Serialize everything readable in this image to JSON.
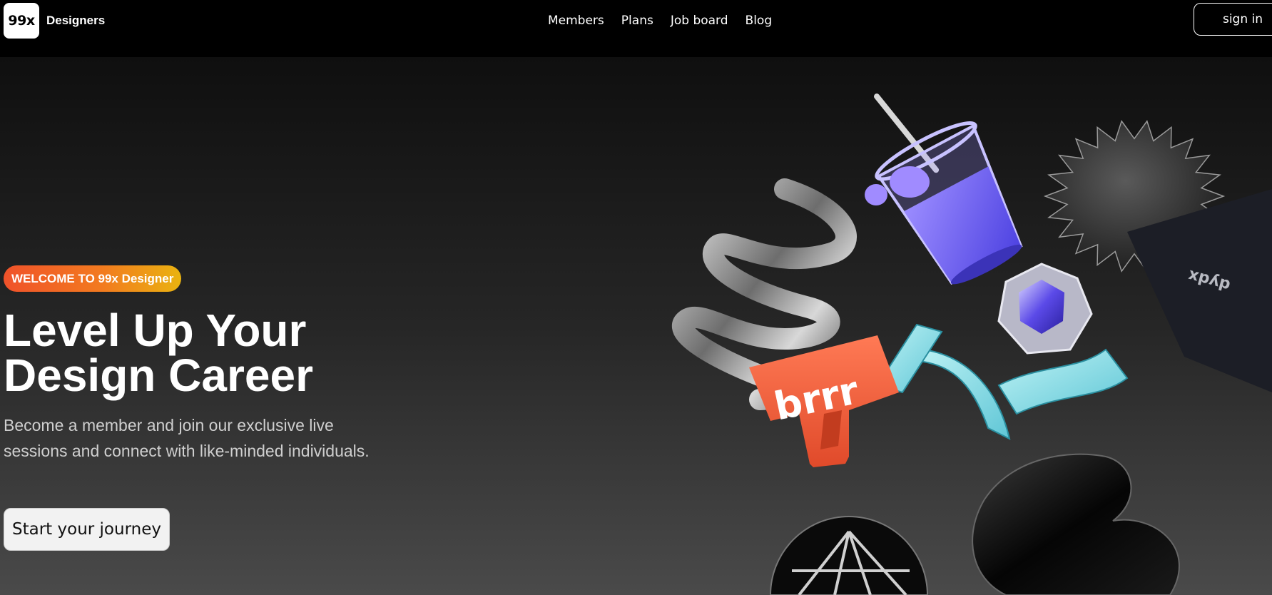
{
  "brand": {
    "logo_mark": "99x",
    "name": "Designers"
  },
  "nav": {
    "items": [
      "Members",
      "Plans",
      "Job board",
      "Blog"
    ]
  },
  "header": {
    "signin_label": "sign in"
  },
  "hero": {
    "badge": "WELCOME TO 99x Designer",
    "headline_line1": "Level Up Your",
    "headline_line2": "Design Career",
    "subtext_line1": "Become a member and join our exclusive live",
    "subtext_line2": "sessions and connect with like-minded individuals.",
    "cta_label": "Start your journey"
  },
  "illustration": {
    "gun_text": "brrr",
    "card_text": "dydx",
    "colors": {
      "gun": "#f06540",
      "cup_liquid": "#6e63f4",
      "badge_start": "#f0522a",
      "badge_end": "#eab310"
    }
  }
}
